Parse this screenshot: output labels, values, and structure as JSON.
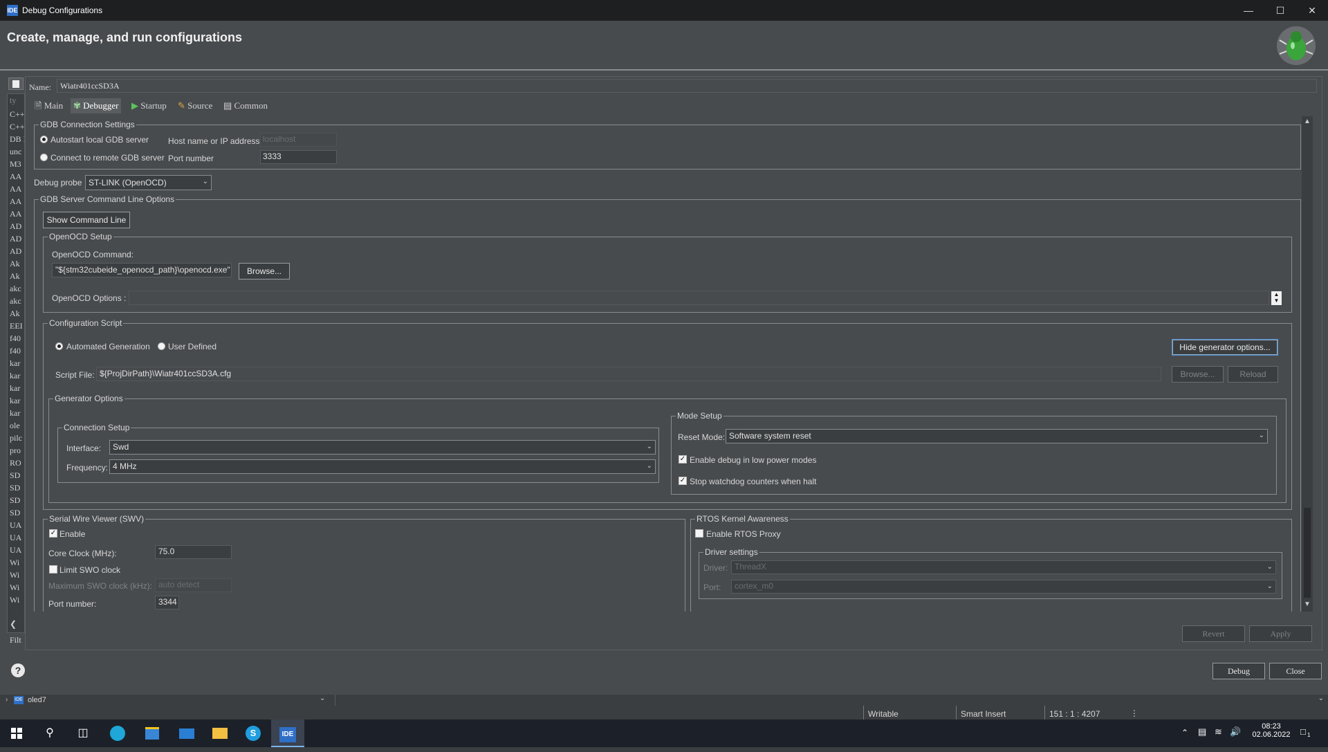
{
  "window": {
    "title": "Debug Configurations",
    "app_badge": "IDE"
  },
  "header": {
    "title": "Create, manage, and run configurations"
  },
  "left_list": {
    "items": [
      "C++",
      "C++",
      "DB E",
      "unc",
      "M3",
      "AA",
      "AA",
      "AA",
      "AA",
      "AD",
      "AD",
      "AD",
      "Ak",
      "Ak",
      "akc",
      "akc",
      "Ak",
      "EEI",
      "f40",
      "f40",
      "kar",
      "kar",
      "kar",
      "kar",
      "kar",
      "ole",
      "pilc",
      "pro",
      "RO",
      "SD",
      "SD",
      "SD",
      "SD",
      "UA",
      "UA",
      "UA",
      "Wi",
      "Wi",
      "Wi",
      "Wi"
    ],
    "filter_label": "Filt",
    "search_placeholder": "ty"
  },
  "name_row": {
    "label": "Name:",
    "value": "Wiatr401ccSD3A"
  },
  "tabs": [
    {
      "label": "Main"
    },
    {
      "label": "Debugger"
    },
    {
      "label": "Startup"
    },
    {
      "label": "Source"
    },
    {
      "label": "Common"
    }
  ],
  "gdb_connection": {
    "title": "GDB Connection Settings",
    "autostart_label": "Autostart local GDB server",
    "remote_label": "Connect to remote GDB server",
    "host_label": "Host name or IP address",
    "host_value": "localhost",
    "port_label": "Port number",
    "port_value": "3333"
  },
  "debug_probe": {
    "label": "Debug probe",
    "value": "ST-LINK (OpenOCD)"
  },
  "gdb_server_options": {
    "title": "GDB Server Command Line Options",
    "show_cmd_button": "Show Command Line",
    "openocd_setup_title": "OpenOCD Setup",
    "command_label": "OpenOCD Command:",
    "command_value": "\"${stm32cubeide_openocd_path}\\openocd.exe\"",
    "browse_label": "Browse...",
    "options_label": "OpenOCD Options :"
  },
  "config_script": {
    "title": "Configuration Script",
    "auto_label": "Automated Generation",
    "user_label": "User Defined",
    "hide_gen_button": "Hide generator options...",
    "script_file_label": "Script File:",
    "script_file_value": "${ProjDirPath}\\Wiatr401ccSD3A.cfg",
    "browse_label": "Browse...",
    "reload_label": "Reload"
  },
  "generator_options": {
    "title": "Generator Options",
    "connection_setup_title": "Connection Setup",
    "interface_label": "Interface:",
    "interface_value": "Swd",
    "frequency_label": "Frequency:",
    "frequency_value": "4 MHz",
    "mode_setup_title": "Mode Setup",
    "reset_mode_label": "Reset Mode:",
    "reset_mode_value": "Software system reset",
    "low_power_label": "Enable debug in low power modes",
    "watchdog_label": "Stop watchdog counters when halt"
  },
  "swv": {
    "title": "Serial Wire Viewer (SWV)",
    "enable_label": "Enable",
    "core_clock_label": "Core Clock (MHz):",
    "core_clock_value": "75.0",
    "limit_swo_label": "Limit SWO clock",
    "max_swo_label": "Maximum SWO clock (kHz):",
    "max_swo_value": "auto detect",
    "port_label": "Port number:",
    "port_value": "3344"
  },
  "rtos": {
    "title": "RTOS Kernel Awareness",
    "enable_proxy_label": "Enable RTOS Proxy",
    "driver_settings_title": "Driver settings",
    "driver_label": "Driver:",
    "driver_value": "ThreadX",
    "port_label": "Port:",
    "port_value": "cortex_m0"
  },
  "footer_buttons": {
    "revert": "Revert",
    "apply": "Apply",
    "debug": "Debug",
    "close": "Close"
  },
  "statusbar": {
    "project": "oled7",
    "writable": "Writable",
    "insert_mode": "Smart Insert",
    "position": "151 : 1 : 4207"
  },
  "taskbar": {
    "time": "08:23",
    "date": "02.06.2022",
    "notification_count": "1",
    "ide_label": "IDE"
  },
  "colors": {
    "accent": "#2f6fc6",
    "title_bg": "#1e1f20",
    "panel_bg": "#484b4e",
    "taskbar_bg": "#1c2129"
  }
}
